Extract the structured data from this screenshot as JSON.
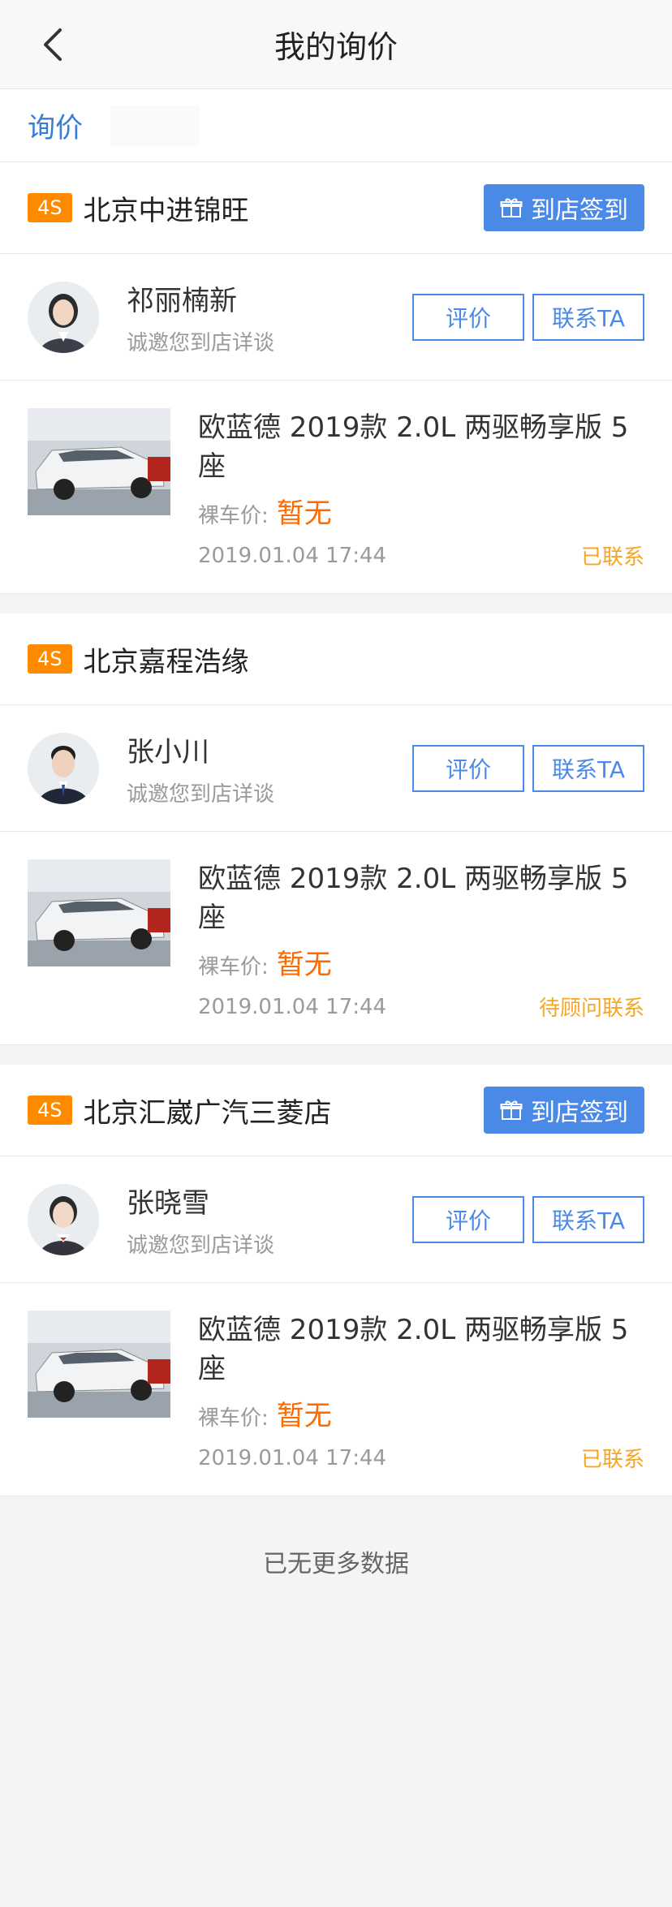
{
  "nav": {
    "title": "我的询价"
  },
  "tabs": {
    "active_label": "询价"
  },
  "dealer_badge": "4S",
  "checkin_label": "到店签到",
  "rate_label": "评价",
  "contact_label": "联系TA",
  "invite_text": "诚邀您到店详谈",
  "price_label": "裸车价:",
  "cards": [
    {
      "dealer": "北京中进锦旺",
      "has_checkin": true,
      "consultant": "祁丽楠新",
      "car_title": "欧蓝德 2019款 2.0L 两驱畅享版 5座",
      "price": "暂无",
      "timestamp": "2019.01.04 17:44",
      "status": "已联系"
    },
    {
      "dealer": "北京嘉程浩缘",
      "has_checkin": false,
      "consultant": "张小川",
      "car_title": "欧蓝德 2019款 2.0L 两驱畅享版 5座",
      "price": "暂无",
      "timestamp": "2019.01.04 17:44",
      "status": "待顾问联系"
    },
    {
      "dealer": "北京汇崴广汽三菱店",
      "has_checkin": true,
      "consultant": "张晓雪",
      "car_title": "欧蓝德 2019款 2.0L 两驱畅享版 5座",
      "price": "暂无",
      "timestamp": "2019.01.04 17:44",
      "status": "已联系"
    }
  ],
  "footer": {
    "no_more": "已无更多数据"
  },
  "colors": {
    "accent": "#4a8ae6",
    "badge": "#ff8a00",
    "price": "#ff6a00",
    "status": "#f5a623"
  },
  "icons": {
    "back": "chevron-left-icon",
    "gift": "gift-icon"
  }
}
